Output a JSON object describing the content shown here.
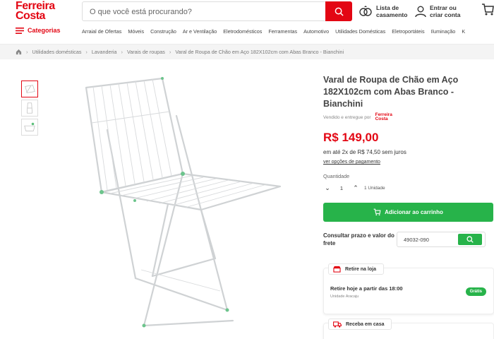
{
  "header": {
    "logo_line1": "Ferreira",
    "logo_line2": "Costa",
    "search_placeholder": "O que você está procurando?",
    "wedding_list": "Lista de casamento",
    "account": "Entrar ou criar conta",
    "colors": {
      "brand": "#e30613",
      "green": "#27b34a"
    }
  },
  "nav": {
    "categories_label": "Categorias",
    "items": [
      "Arraial de Ofertas",
      "Móveis",
      "Construção",
      "Ar e Ventilação",
      "Eletrodomésticos",
      "Ferramentas",
      "Automotivo",
      "Utilidades Domésticas",
      "Eletroportáteis",
      "Iluminação",
      "K"
    ]
  },
  "breadcrumb": [
    "Utilidades domésticas",
    "Lavanderia",
    "Varais de roupas",
    "Varal de Roupa de Chão em Aço 182X102cm com Abas Branco - Bianchini"
  ],
  "product": {
    "title": "Varal de Roupa de Chão em Aço 182X102cm com Abas Branco - Bianchini",
    "seller_text": "Vendido e entregue por",
    "seller_logo": "Ferreira Costa",
    "price": "R$ 149,00",
    "installments": "em até 2x de R$ 74,50 sem juros",
    "payment_options": "ver opções de pagamento",
    "quantity_label": "Quantidade",
    "quantity_value": "1",
    "quantity_unit": "1 Unidade",
    "add_to_cart": "Adicionar ao carrinho",
    "shipping_label": "Consultar prazo e valor do frete",
    "cep_value": "49032-090",
    "pickup": {
      "tab": "Retire na loja",
      "line1": "Retire hoje a partir das 18:00",
      "line2": "Unidade Aracaju",
      "badge": "Grátis"
    },
    "home_delivery": {
      "tab": "Receba em casa"
    }
  }
}
